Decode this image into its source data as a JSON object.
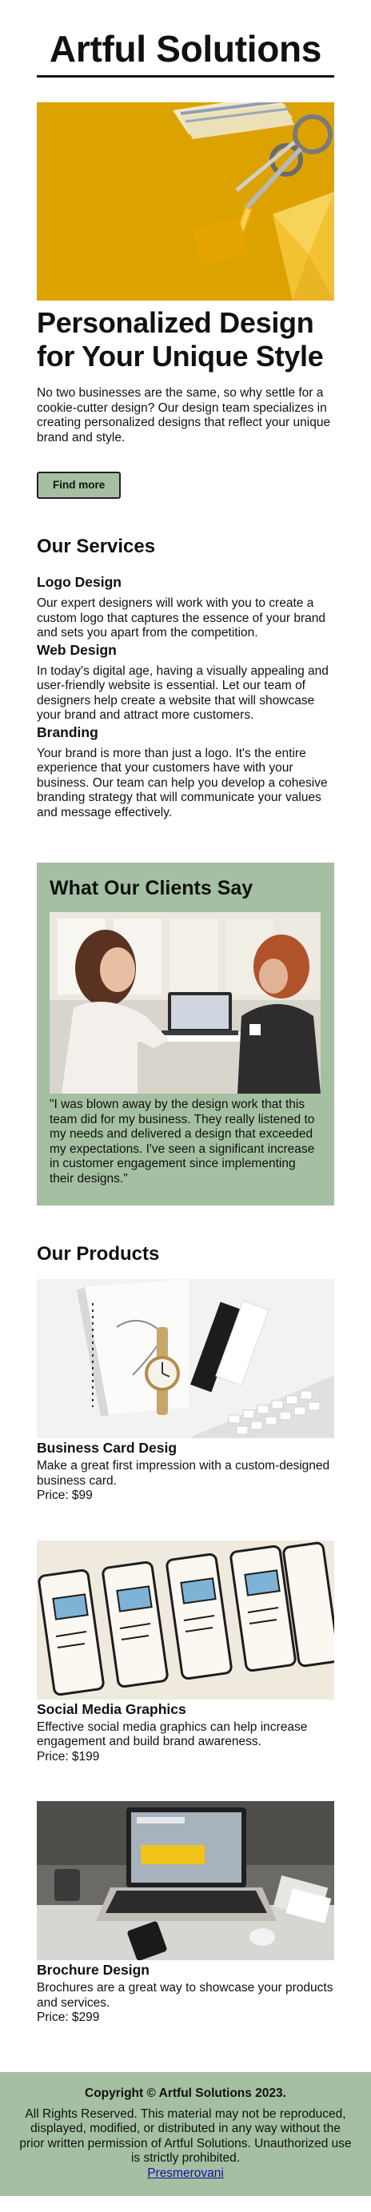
{
  "header": {
    "title": "Artful Solutions"
  },
  "hero": {
    "heading": "Personalized Design for Your Unique Style",
    "text": "No two businesses are the same, so why settle for a cookie-cutter design? Our design team specializes in creating personalized designs that reflect your unique brand and style.",
    "button_label": "Find more"
  },
  "services": {
    "heading": "Our Services",
    "items": [
      {
        "title": "Logo Design",
        "text": "Our expert designers will work with you to create a custom logo that captures the essence of your brand and sets you apart from the competition."
      },
      {
        "title": "Web Design",
        "text": "In today's digital age, having a visually appealing and user-friendly website is essential. Let our team of designers help create a website that will showcase your brand and attract more customers."
      },
      {
        "title": "Branding",
        "text": "Your brand is more than just a logo. It's the entire experience that your customers have with your business. Our team can help you develop a cohesive branding strategy that will communicate your values and message effectively."
      }
    ]
  },
  "testimonials": {
    "heading": "What Our Clients Say",
    "quote": "\"I was blown away by the design work that this team did for my business. They really listened to my needs and delivered a design that exceeded my expectations. I've seen a significant increase in customer engagement since implementing their designs.\""
  },
  "products": {
    "heading": "Our Products",
    "items": [
      {
        "title": "Business Card Desig",
        "desc": "Make a great first impression with a custom-designed business card.",
        "price": "Price: $99"
      },
      {
        "title": "Social Media Graphics",
        "desc": "Effective social media graphics can help increase engagement and build brand awareness.",
        "price": "Price: $199"
      },
      {
        "title": "Brochure Design",
        "desc": "Brochures are a great way to showcase your products and services.",
        "price": "Price: $299"
      }
    ]
  },
  "footer": {
    "copyright": "Copyright © Artful Solutions 2023.",
    "rights": "All Rights Reserved. This material may not be reproduced, displayed, modified, or distributed in any way without the prior written permission of Artful Solutions. Unauthorized use is strictly prohibited.",
    "link_label": "Presmerovani"
  },
  "colors": {
    "accent_green": "#a4bfa1",
    "text": "#111111",
    "link": "#1a0dab"
  },
  "icons": [
    "hero-photo",
    "testimonial-photo",
    "business-card-photo",
    "wireframe-sketch-photo",
    "laptop-desk-photo"
  ]
}
